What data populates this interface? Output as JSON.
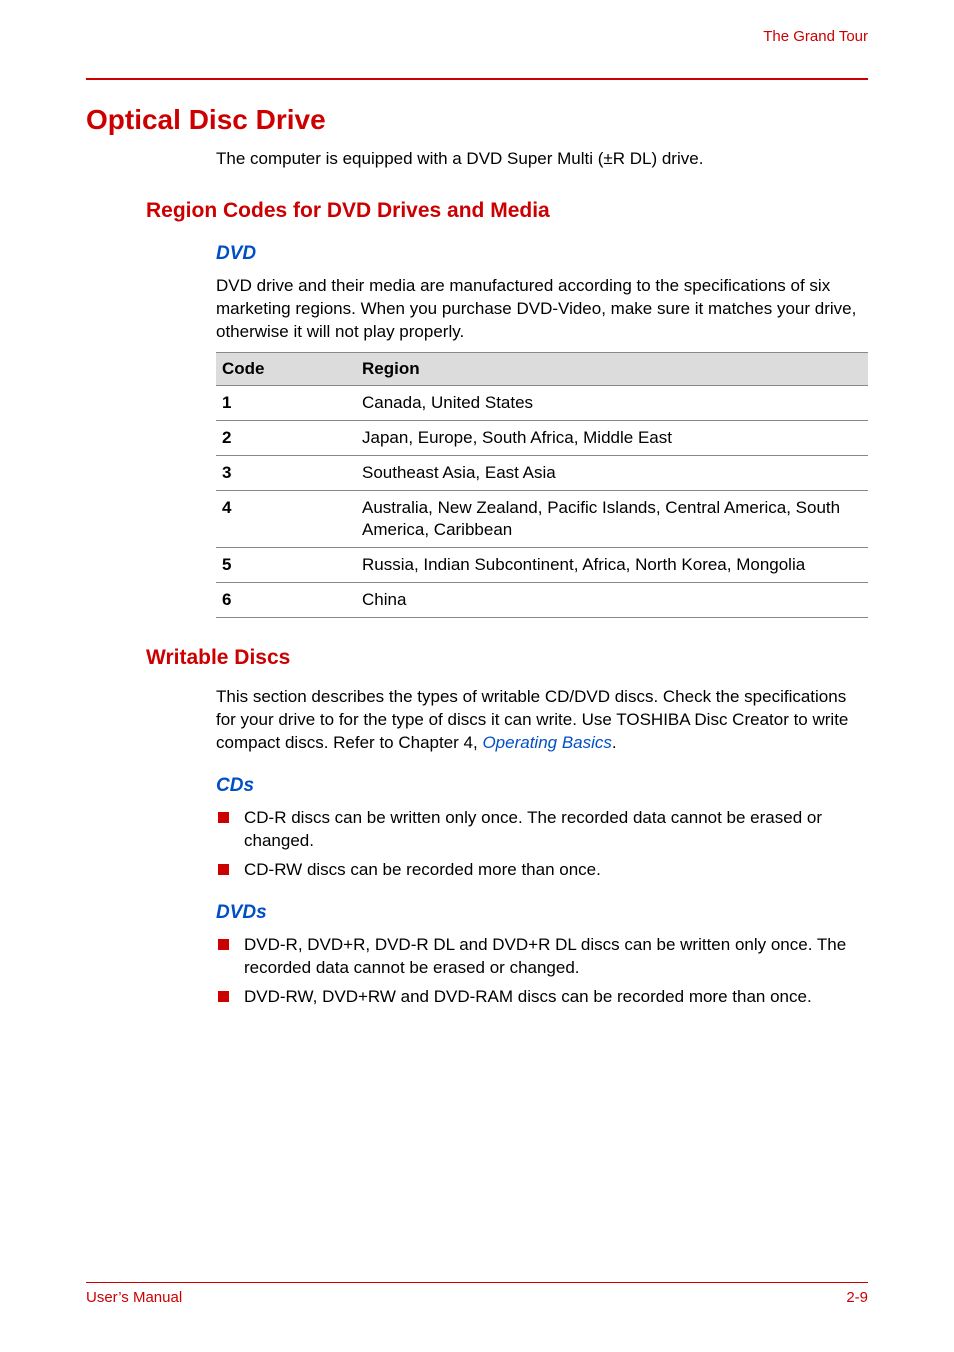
{
  "header": {
    "section": "The Grand Tour"
  },
  "h1": "Optical Disc Drive",
  "intro": "The computer is equipped with a DVD Super Multi (±R DL) drive.",
  "h2_region": "Region Codes for DVD Drives and Media",
  "dvd": {
    "heading": "DVD",
    "para": "DVD drive and their media are manufactured according to the specifications of six marketing regions. When you purchase DVD-Video, make sure it matches your drive, otherwise it will not play properly.",
    "columns": {
      "code": "Code",
      "region": "Region"
    },
    "rows": [
      {
        "code": "1",
        "region": "Canada, United States"
      },
      {
        "code": "2",
        "region": "Japan, Europe, South Africa, Middle East"
      },
      {
        "code": "3",
        "region": "Southeast Asia, East Asia"
      },
      {
        "code": "4",
        "region": "Australia, New Zealand, Pacific Islands, Central America, South America, Caribbean"
      },
      {
        "code": "5",
        "region": "Russia, Indian Subcontinent, Africa, North Korea, Mongolia"
      },
      {
        "code": "6",
        "region": "China"
      }
    ]
  },
  "h2_writable": "Writable Discs",
  "writable": {
    "para_pre": "This section describes the types of writable CD/DVD discs. Check the specifications for your drive to for the type of discs it can write. Use TOSHIBA Disc Creator to write compact discs. Refer to Chapter 4, ",
    "link": "Operating Basics",
    "para_post": "."
  },
  "cds": {
    "heading": "CDs",
    "items": [
      "CD-R discs can be written only once. The recorded data cannot be erased or changed.",
      "CD-RW discs can be recorded more than once."
    ]
  },
  "dvds": {
    "heading": "DVDs",
    "items": [
      "DVD-R, DVD+R, DVD-R DL and DVD+R DL discs can be written only once. The recorded data cannot be erased or changed.",
      "DVD-RW, DVD+RW and DVD-RAM discs can be recorded more than once."
    ]
  },
  "footer": {
    "left": "User’s Manual",
    "right": "2-9"
  }
}
